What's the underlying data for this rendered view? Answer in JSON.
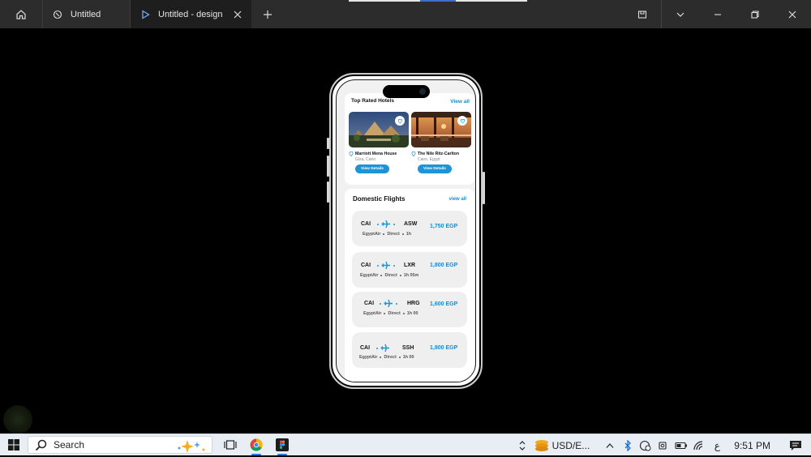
{
  "titlebar": {
    "tabs": [
      {
        "label": "Untitled"
      },
      {
        "label": "Untitled - design"
      }
    ]
  },
  "hotels": {
    "title": "Top Rated  Hotels",
    "view_all": "View all",
    "items": [
      {
        "name": "Marriott Mena House",
        "location": "Giza, Cairo",
        "button": "View Details"
      },
      {
        "name": "The Nile Ritz-Carlton",
        "location": "Cairo, Egypt",
        "button": "View Details"
      }
    ]
  },
  "flights": {
    "title": "Domestic Flights",
    "view_all": "view all",
    "items": [
      {
        "from": "CAI",
        "to": "ASW",
        "airline": "EgyptAir",
        "type": "Direct",
        "duration": "1h",
        "price": "1,750 EGP"
      },
      {
        "from": "CAI",
        "to": "LXR",
        "airline": "EgyptAir",
        "type": "Direct",
        "duration": "1h 05m",
        "price": "1,800 EGP"
      },
      {
        "from": "CAI",
        "to": "HRG",
        "airline": "EgyptAir",
        "type": "Direct",
        "duration": "1h 00",
        "price": "1,600 EGP"
      },
      {
        "from": "CAI",
        "to": "SSH",
        "airline": "EgyptAir",
        "type": "Direct",
        "duration": "1h 00",
        "price": "1,800 EGP"
      }
    ]
  },
  "taskbar": {
    "search_label": "Search",
    "currency": "USD/E...",
    "lang": "ع",
    "time": "9:51 PM"
  },
  "colors": {
    "accent": "#1e94d6",
    "titlebar": "#2c2c2c",
    "taskbar": "#e9eef5"
  }
}
